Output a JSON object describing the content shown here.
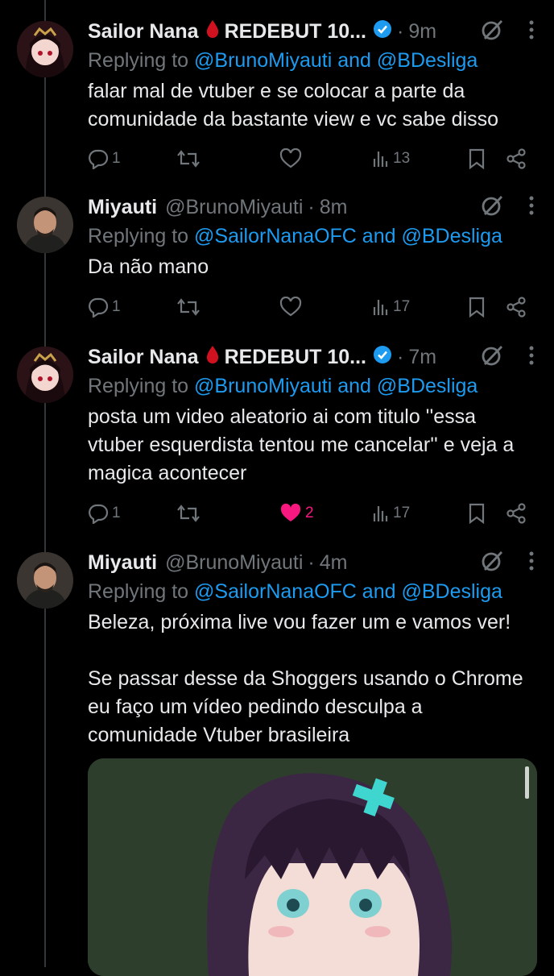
{
  "tweets": [
    {
      "name": "Sailor Nana",
      "name_suffix": "REDEBUT 10...",
      "handle": "",
      "time": "9m",
      "replying_prefix": "Replying to",
      "replying_links": "@BrunoMiyauti and @BDesliga",
      "text": "falar mal de vtuber e se colocar a parte da comunidade da bastante view e vc sabe disso",
      "replies": "1",
      "retweets": "",
      "likes": "",
      "views": "13"
    },
    {
      "name": "Miyauti",
      "name_suffix": "",
      "handle": "@BrunoMiyauti",
      "time": "8m",
      "replying_prefix": "Replying to",
      "replying_links": "@SailorNanaOFC and @BDesliga",
      "text": "Da não mano",
      "replies": "1",
      "retweets": "",
      "likes": "",
      "views": "17"
    },
    {
      "name": "Sailor Nana",
      "name_suffix": "REDEBUT 10...",
      "handle": "",
      "time": "7m",
      "replying_prefix": "Replying to",
      "replying_links": "@BrunoMiyauti and @BDesliga",
      "text": "posta um video aleatorio ai com titulo ''essa vtuber esquerdista tentou me cancelar'' e veja a magica acontecer",
      "replies": "1",
      "retweets": "",
      "likes": "2",
      "views": "17"
    },
    {
      "name": "Miyauti",
      "name_suffix": "",
      "handle": "@BrunoMiyauti",
      "time": "4m",
      "replying_prefix": "Replying to",
      "replying_links": "@SailorNanaOFC and @BDesliga",
      "text_p1": "Beleza, próxima live vou fazer um e vamos ver!",
      "text_p2": "Se passar desse da Shoggers usando o Chrome eu faço um vídeo pedindo desculpa a comunidade Vtuber brasileira"
    }
  ],
  "colors": {
    "background": "#000000",
    "text": "#e7e9ea",
    "muted": "#71767b",
    "link": "#1d9bf0",
    "like": "#f91880",
    "verified": "#1d9bf0"
  },
  "icons": [
    "reply-icon",
    "retweet-icon",
    "like-icon",
    "views-icon",
    "bookmark-icon",
    "share-icon",
    "grok-icon",
    "more-icon",
    "verified-icon",
    "blood-drop-icon"
  ]
}
